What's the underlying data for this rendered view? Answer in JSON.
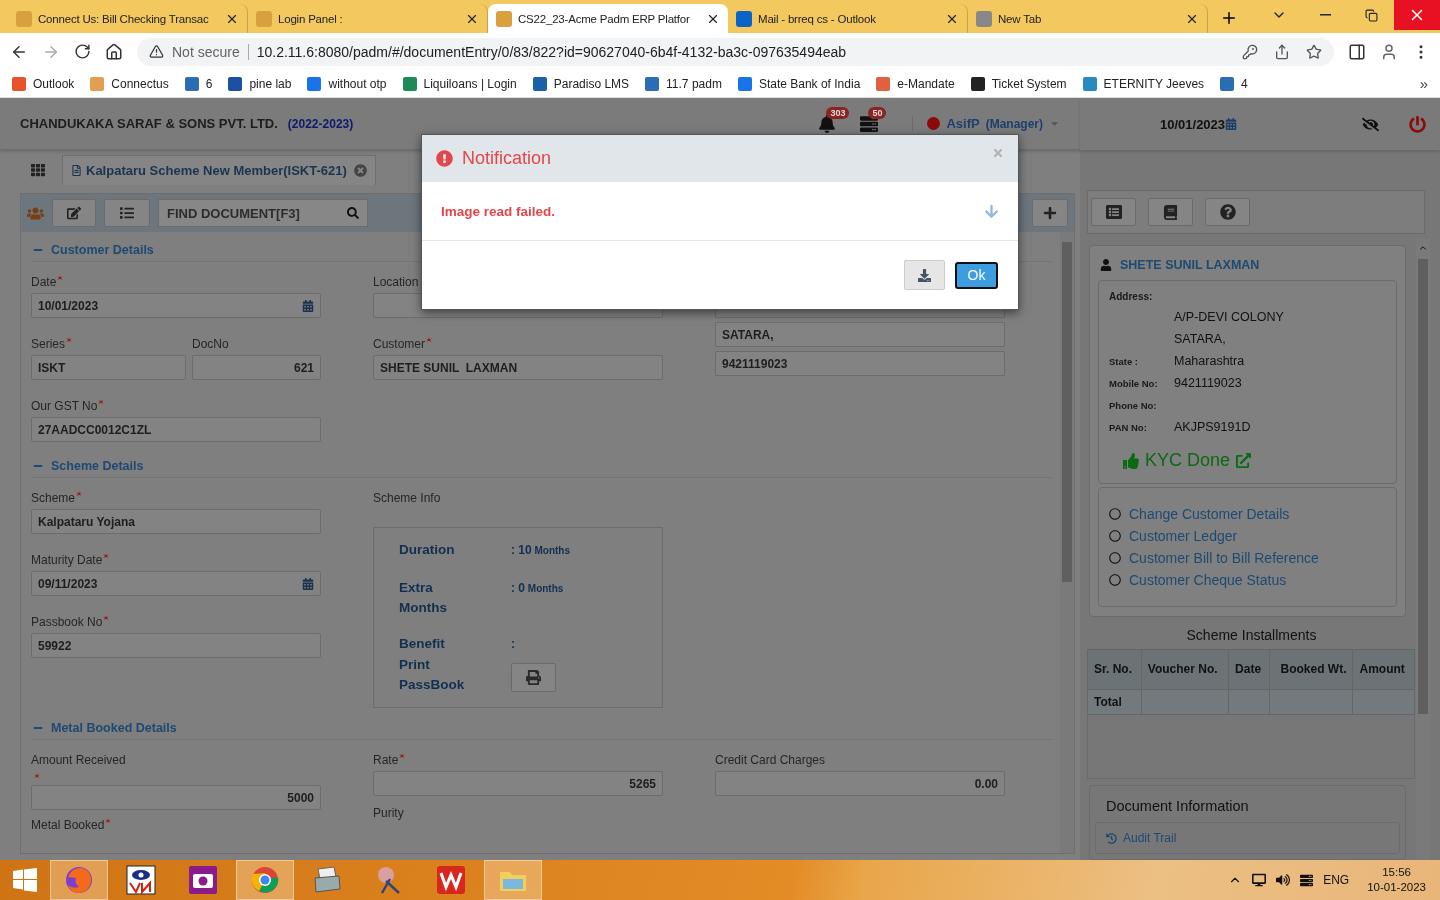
{
  "browser": {
    "tabs": [
      {
        "title": "Connect Us: Bill Checking Transac",
        "selected": false
      },
      {
        "title": "Login Panel :",
        "selected": false
      },
      {
        "title": "CS22_23-Acme Padm ERP Platfor",
        "selected": true
      },
      {
        "title": "Mail - brreq cs - Outlook",
        "selected": false
      },
      {
        "title": "New Tab",
        "selected": false
      }
    ],
    "address": {
      "security": "Not secure",
      "url": "10.2.11.6:8080/padm/#/documentEntry/0/83/822?id=90627040-6b4f-4132-ba3c-097635494eab"
    },
    "bookmarks": [
      {
        "label": "Outlook",
        "color": "#e8532b"
      },
      {
        "label": "Connectus",
        "color": "#e0a050"
      },
      {
        "label": "6",
        "color": "#2a6db5"
      },
      {
        "label": "pine lab",
        "color": "#1d4fa3"
      },
      {
        "label": "without otp",
        "color": "#1a73e8"
      },
      {
        "label": "Liquiloans | Login",
        "color": "#1e8a5a"
      },
      {
        "label": "Paradiso LMS",
        "color": "#1b5fa8"
      },
      {
        "label": "11.7 padm",
        "color": "#2a6db5"
      },
      {
        "label": "State Bank of India",
        "color": "#1a73e8"
      },
      {
        "label": "e-Mandate",
        "color": "#e06040"
      },
      {
        "label": "Ticket System",
        "color": "#222222"
      },
      {
        "label": "ETERNITY Jeeves",
        "color": "#2a8ac0"
      },
      {
        "label": "4",
        "color": "#2a6db5"
      }
    ],
    "overflow": "»"
  },
  "app": {
    "company": "CHANDUKAKA SARAF & SONS PVT. LTD.",
    "year": "(2022-2023)",
    "notifications": "303",
    "messages": "50",
    "user": "AsifP",
    "role": "(Manager)",
    "date": "10/01/2023"
  },
  "document_tab": {
    "title": "Kalpataru Scheme New Member(ISKT-621)"
  },
  "toolbar": {
    "search_placeholder": "FIND DOCUMENT[F3]"
  },
  "customer_details": {
    "title": "Customer Details",
    "expanded": true,
    "date": {
      "label": "Date",
      "required": true,
      "value": "10/01/2023"
    },
    "location": {
      "label": "Location",
      "required": false
    },
    "series": {
      "label": "Series",
      "required": true,
      "value": "ISKT"
    },
    "doc_no": {
      "label": "DocNo",
      "required": false,
      "value": "621"
    },
    "customer": {
      "label": "Customer",
      "required": true,
      "value": "SHETE SUNIL  LAXMAN"
    },
    "gst": {
      "label": "Our GST No",
      "required": true,
      "value": "27AADCC0012C1ZL"
    },
    "address": [
      "SATARA,",
      "9421119023"
    ]
  },
  "scheme_details": {
    "title": "Scheme Details",
    "expanded": true,
    "scheme": {
      "label": "Scheme",
      "required": true,
      "value": "Kalpataru Yojana"
    },
    "maturity_date": {
      "label": "Maturity Date",
      "required": true,
      "value": "09/11/2023"
    },
    "passbook_no": {
      "label": "Passbook No",
      "required": true,
      "value": "59922"
    },
    "info": {
      "label": "Scheme Info",
      "rows": [
        {
          "kind": "value",
          "label": "Duration",
          "value": ": 10",
          "unit": "Months"
        },
        {
          "kind": "value",
          "label": "Extra Months",
          "value": ": 0",
          "unit": "Months"
        },
        {
          "kind": "value",
          "label": "Benefit",
          "value": ":"
        },
        {
          "kind": "print",
          "label": "Print PassBook"
        }
      ]
    }
  },
  "metal_booked": {
    "title": "Metal Booked Details",
    "expanded": true,
    "amount_received": {
      "label": "Amount Received",
      "required": true,
      "value": "5000"
    },
    "rate": {
      "label": "Rate",
      "required": true,
      "value": "5265"
    },
    "credit_card_charges": {
      "label": "Credit Card Charges",
      "required": false,
      "value": "0.00"
    },
    "purity": {
      "label": "Purity",
      "required": false
    },
    "metal_booked": {
      "label": "Metal Booked",
      "required": true
    }
  },
  "sidebar": {
    "customer": {
      "name": "SHETE SUNIL LAXMAN",
      "address_label": "Address:",
      "address_lines": [
        "A/P-DEVI COLONY",
        "SATARA,"
      ],
      "details": [
        {
          "label": "State :",
          "value": "Maharashtra"
        },
        {
          "label": "Mobile No:",
          "value": "9421119023"
        },
        {
          "label": "Phone No:"
        },
        {
          "label": "PAN No:",
          "value": "AKJPS9191D"
        }
      ],
      "kyc": "KYC Done"
    },
    "links": [
      {
        "label": "Change Customer Details",
        "selected": false
      },
      {
        "label": "Customer Ledger",
        "selected": false
      },
      {
        "label": "Customer Bill to Bill Reference",
        "selected": false
      },
      {
        "label": "Customer Cheque Status",
        "selected": false
      }
    ],
    "installments": {
      "title": "Scheme Installments",
      "columns": [
        "Sr. No.",
        "Voucher No.",
        "Date",
        "Booked Wt.",
        "Amount"
      ],
      "total_label": "Total"
    },
    "document_info": {
      "title": "Document Information",
      "audit_trail": "Audit Trail"
    }
  },
  "modal": {
    "title": "Notification",
    "message": "Image read failed.",
    "ok": "Ok"
  },
  "taskbar": {
    "apps": [
      {
        "kind": "fox",
        "running": true
      },
      {
        "kind": "eye",
        "running": false
      },
      {
        "kind": "camera",
        "running": false
      },
      {
        "kind": "wheel",
        "running": true
      },
      {
        "kind": "printer",
        "running": false
      },
      {
        "kind": "scissors",
        "running": false
      },
      {
        "kind": "letter",
        "running": false
      },
      {
        "kind": "folder",
        "running": true
      }
    ],
    "language": "ENG",
    "time": "15:56",
    "date": "10-01-2023"
  }
}
